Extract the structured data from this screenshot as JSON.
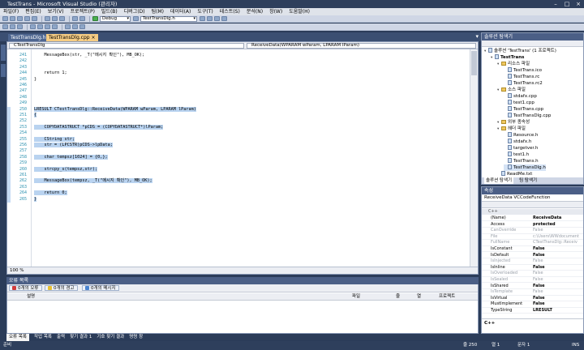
{
  "window": {
    "title": "TestTrans - Microsoft Visual Studio (관리자)"
  },
  "menu": [
    "파일(F)",
    "편집(E)",
    "보기(V)",
    "프로젝트(P)",
    "빌드(B)",
    "디버그(D)",
    "팀(M)",
    "데이터(A)",
    "도구(T)",
    "테스트(S)",
    "분석(N)",
    "창(W)",
    "도움말(H)"
  ],
  "toolbar": {
    "config": "Debug",
    "file": "TestTransDlg.h"
  },
  "tabs": [
    {
      "label": "TestTransDlg.h",
      "active": false
    },
    {
      "label": "TestTransDlg.cpp",
      "active": true
    }
  ],
  "nav": {
    "class": "CTestTransDlg",
    "member": "ReceiveData(WPARAM wParam, LPARAM lParam)"
  },
  "code": {
    "lines": [
      {
        "n": "241",
        "t": "    MessageBox(str, _T(\"메시지 확인\"), MB_OK);",
        "hl": false
      },
      {
        "n": "242",
        "t": "",
        "hl": false
      },
      {
        "n": "243",
        "t": "",
        "hl": false
      },
      {
        "n": "244",
        "t": "    return 1;",
        "hl": false
      },
      {
        "n": "245",
        "t": "}",
        "hl": false
      },
      {
        "n": "246",
        "t": "",
        "hl": false
      },
      {
        "n": "247",
        "t": "",
        "hl": false
      },
      {
        "n": "248",
        "t": "",
        "hl": false
      },
      {
        "n": "249",
        "t": "",
        "hl": false
      },
      {
        "n": "250",
        "t": "LRESULT CTestTransDlg::ReceiveData(WPARAM wParam, LPARAM lParam)",
        "hl": true
      },
      {
        "n": "251",
        "t": "{",
        "hl": true
      },
      {
        "n": "252",
        "t": "",
        "hl": true
      },
      {
        "n": "253",
        "t": "    COPYDATASTRUCT *pCDS = (COPYDATASTRUCT*)lParam;",
        "hl": true
      },
      {
        "n": "254",
        "t": "",
        "hl": true
      },
      {
        "n": "255",
        "t": "    CString str;",
        "hl": true
      },
      {
        "n": "256",
        "t": "    str = (LPCSTR)pCDS->lpData;",
        "hl": true
      },
      {
        "n": "257",
        "t": "",
        "hl": true
      },
      {
        "n": "258",
        "t": "    char tempsz[1024] = {0,};",
        "hl": true
      },
      {
        "n": "259",
        "t": "",
        "hl": true
      },
      {
        "n": "260",
        "t": "    strcpy_s(tempsz,str);",
        "hl": true
      },
      {
        "n": "261",
        "t": "",
        "hl": true
      },
      {
        "n": "262",
        "t": "    MessageBox(tempsz, _T(\"메시지 확인\"), MB_OK);",
        "hl": true
      },
      {
        "n": "263",
        "t": "",
        "hl": true
      },
      {
        "n": "264",
        "t": "    return 0;",
        "hl": true
      },
      {
        "n": "265",
        "t": "}",
        "hl": true
      }
    ]
  },
  "zoom": "100 %",
  "solution": {
    "title": "솔루션 탐색기",
    "items": [
      {
        "label": "솔루션 'TestTrans' (1 프로젝트)",
        "depth": 0,
        "kind": "sol"
      },
      {
        "label": "TestTrans",
        "depth": 1,
        "kind": "proj"
      },
      {
        "label": "리소스 파일",
        "depth": 2,
        "kind": "folder"
      },
      {
        "label": "TestTrans.ico",
        "depth": 3,
        "kind": "file"
      },
      {
        "label": "TestTrans.rc",
        "depth": 3,
        "kind": "file"
      },
      {
        "label": "TestTrans.rc2",
        "depth": 3,
        "kind": "file"
      },
      {
        "label": "소스 파일",
        "depth": 2,
        "kind": "folder"
      },
      {
        "label": "stdafx.cpp",
        "depth": 3,
        "kind": "file"
      },
      {
        "label": "test1.cpp",
        "depth": 3,
        "kind": "file"
      },
      {
        "label": "TestTrans.cpp",
        "depth": 3,
        "kind": "file"
      },
      {
        "label": "TestTransDlg.cpp",
        "depth": 3,
        "kind": "file"
      },
      {
        "label": "외부 종속성",
        "depth": 2,
        "kind": "folder"
      },
      {
        "label": "헤더 파일",
        "depth": 2,
        "kind": "folder"
      },
      {
        "label": "Resource.h",
        "depth": 3,
        "kind": "file"
      },
      {
        "label": "stdafx.h",
        "depth": 3,
        "kind": "file"
      },
      {
        "label": "targetver.h",
        "depth": 3,
        "kind": "file"
      },
      {
        "label": "test1.h",
        "depth": 3,
        "kind": "file"
      },
      {
        "label": "TestTrans.h",
        "depth": 3,
        "kind": "file"
      },
      {
        "label": "TestTransDlg.h",
        "depth": 3,
        "kind": "file"
      },
      {
        "label": "ReadMe.txt",
        "depth": 2,
        "kind": "file"
      }
    ],
    "tabs": [
      "솔루션 탐색기",
      "팀 탐색기"
    ]
  },
  "properties": {
    "title": "속성",
    "object": "ReceiveData  VCCodeFunction",
    "group": "C++",
    "rows": [
      {
        "name": "(Name)",
        "value": "ReceiveData",
        "dim": false
      },
      {
        "name": "Access",
        "value": "protected",
        "dim": false
      },
      {
        "name": "CanOverride",
        "value": "False",
        "dim": true
      },
      {
        "name": "File",
        "value": "c:\\Users\\WWdocument",
        "dim": true
      },
      {
        "name": "FullName",
        "value": "CTestTransDlg::Receiv",
        "dim": true
      },
      {
        "name": "IsConstant",
        "value": "False",
        "dim": false
      },
      {
        "name": "IsDefault",
        "value": "False",
        "dim": false
      },
      {
        "name": "IsInjected",
        "value": "False",
        "dim": true
      },
      {
        "name": "IsInline",
        "value": "False",
        "dim": false
      },
      {
        "name": "IsOverloaded",
        "value": "False",
        "dim": true
      },
      {
        "name": "IsSealed",
        "value": "False",
        "dim": true
      },
      {
        "name": "IsShared",
        "value": "False",
        "dim": false
      },
      {
        "name": "IsTemplate",
        "value": "False",
        "dim": true
      },
      {
        "name": "IsVirtual",
        "value": "False",
        "dim": false
      },
      {
        "name": "MustImplement",
        "value": "False",
        "dim": false
      },
      {
        "name": "TypeString",
        "value": "LRESULT",
        "dim": false
      }
    ],
    "footer": "C++"
  },
  "errors": {
    "title": "오류 목록",
    "errors_btn": "0개의 오류",
    "warnings_btn": "0개의 경고",
    "messages_btn": "0개의 메시지",
    "columns": [
      "설명",
      "파일",
      "줄",
      "열",
      "프로젝트"
    ]
  },
  "bottom_tabs": [
    "오류 목록",
    "작업 목록",
    "출력",
    "찾기 결과 1",
    "기호 찾기 결과",
    "명령 창"
  ],
  "status": {
    "left": "준비",
    "line": "줄 250",
    "col": "열 1",
    "ch": "문자 1",
    "mode": "INS"
  }
}
